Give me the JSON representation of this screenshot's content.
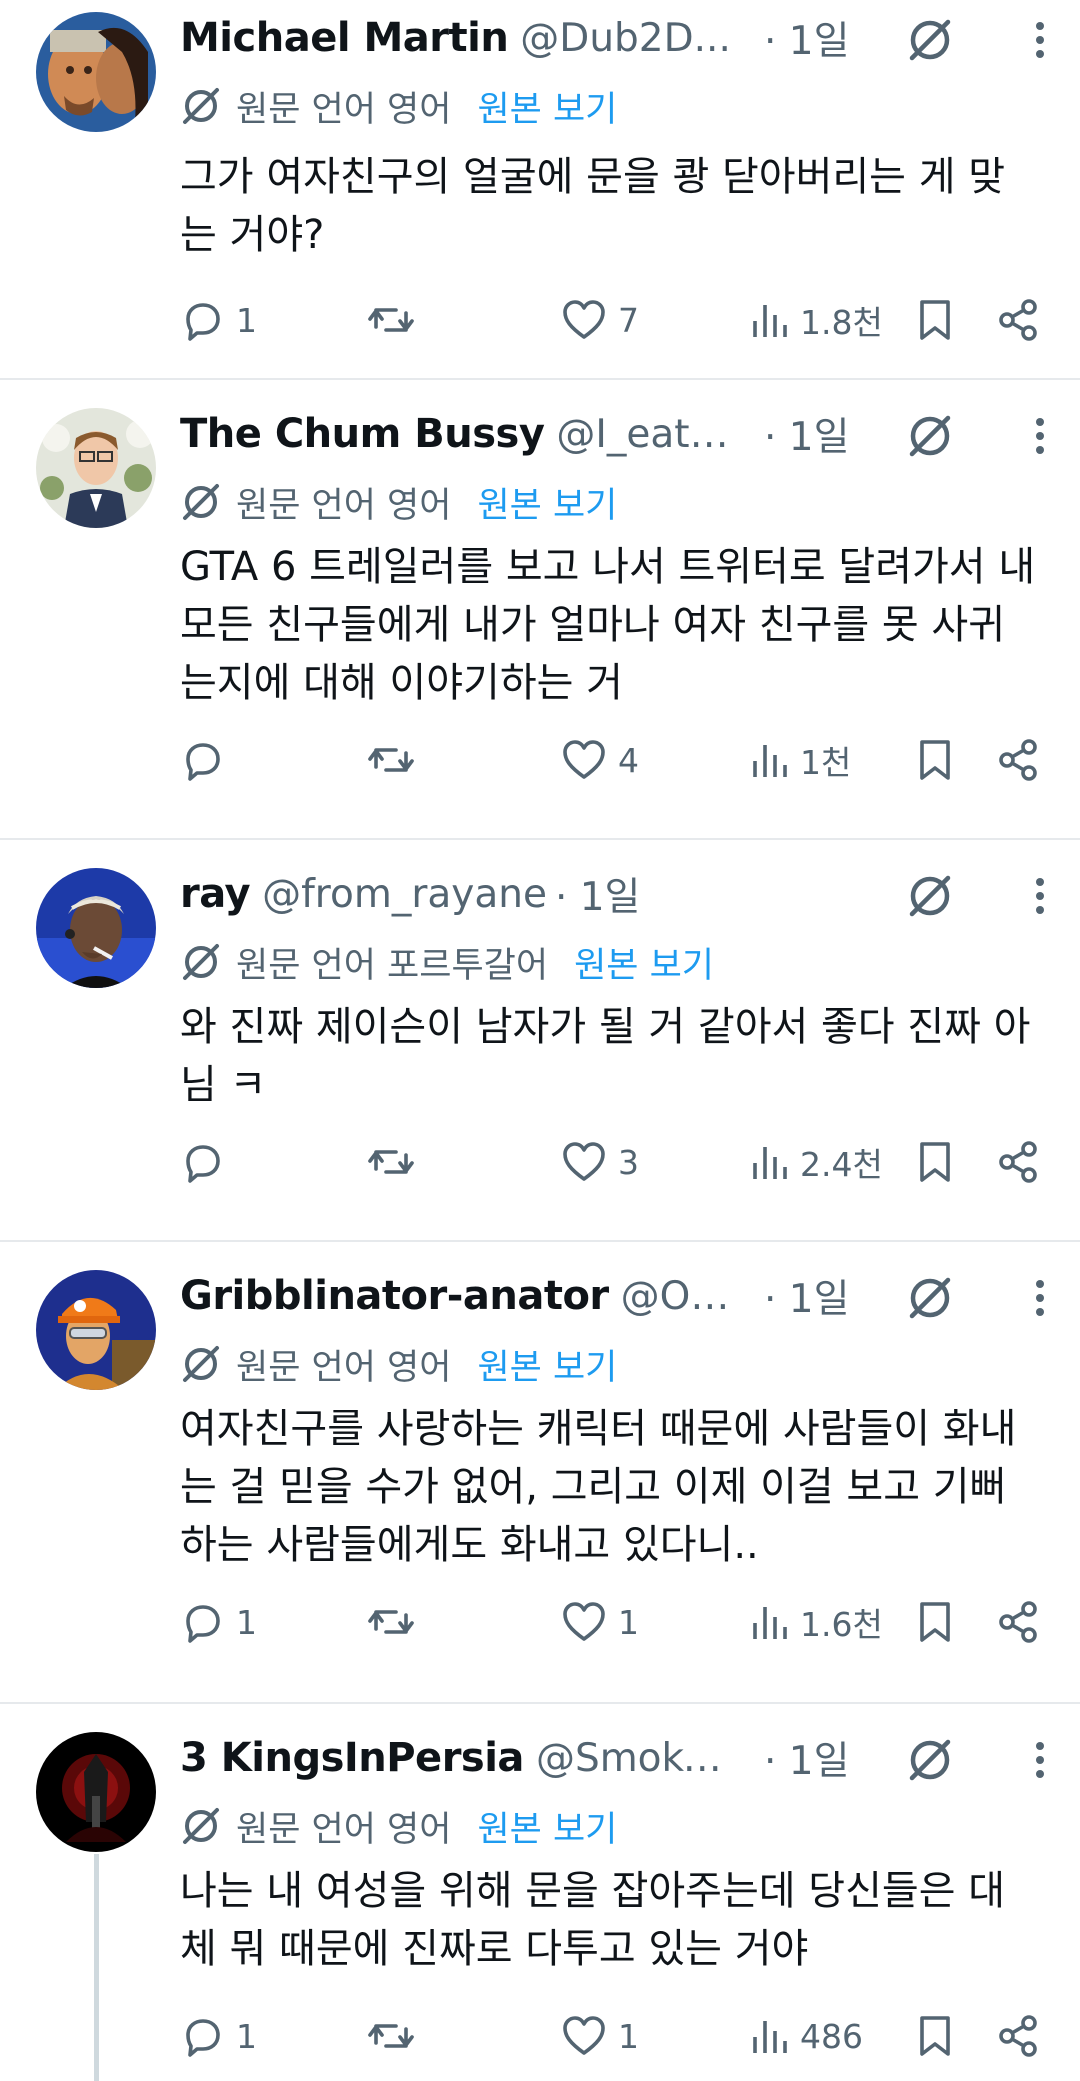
{
  "posts": [
    {
      "name": "Michael Martin",
      "handle": "@Dub2D...",
      "time": "· 1일",
      "translation_label": "원문 언어 영어",
      "translation_link": "원본 보기",
      "text": "그가 여자친구의 얼굴에 문을 쾅 닫아버리는 게 맞는 거야?",
      "replies": "1",
      "reposts": "",
      "likes": "7",
      "views": "1.8천"
    },
    {
      "name": "The Chum Bussy",
      "handle": "@I_eat_s...",
      "time": "· 1일",
      "translation_label": "원문 언어 영어",
      "translation_link": "원본 보기",
      "text": "GTA 6 트레일러를 보고 나서 트위터로 달려가서 내 모든 친구들에게 내가 얼마나 여자 친구를 못 사귀는지에 대해 이야기하는 거",
      "replies": "",
      "reposts": "",
      "likes": "4",
      "views": "1천"
    },
    {
      "name": "ray",
      "handle": "@from_rayane",
      "time": "· 1일",
      "translation_label": "원문 언어 포르투갈어",
      "translation_link": "원본 보기",
      "text": "와 진짜 제이슨이 남자가 될 거 같아서 좋다 진짜 아님 ㅋ",
      "replies": "",
      "reposts": "",
      "likes": "3",
      "views": "2.4천"
    },
    {
      "name": "Gribblinator-anator",
      "handle": "@On...",
      "time": "· 1일",
      "translation_label": "원문 언어 영어",
      "translation_link": "원본 보기",
      "text": "여자친구를 사랑하는 캐릭터 때문에 사람들이 화내는 걸 믿을 수가 없어, 그리고 이제 이걸 보고 기뻐하는 사람들에게도 화내고 있다니..",
      "replies": "1",
      "reposts": "",
      "likes": "1",
      "views": "1.6천"
    },
    {
      "name": "3 KingsInPersia",
      "handle": "@Smoke...",
      "time": "· 1일",
      "translation_label": "원문 언어 영어",
      "translation_link": "원본 보기",
      "text": "나는 내 여성을 위해 문을 잡아주는데 당신들은 대체 뭐 때문에 진짜로 다투고 있는 거야",
      "replies": "1",
      "reposts": "",
      "likes": "1",
      "views": "486"
    }
  ],
  "colors": {
    "text": "#0f1419",
    "secondary": "#536471",
    "link": "#1d9bf0",
    "divider": "#e6e9ec"
  },
  "icons": [
    "grok-icon",
    "more-icon",
    "translate-icon",
    "reply-icon",
    "repost-icon",
    "like-icon",
    "views-icon",
    "bookmark-icon",
    "share-icon"
  ]
}
